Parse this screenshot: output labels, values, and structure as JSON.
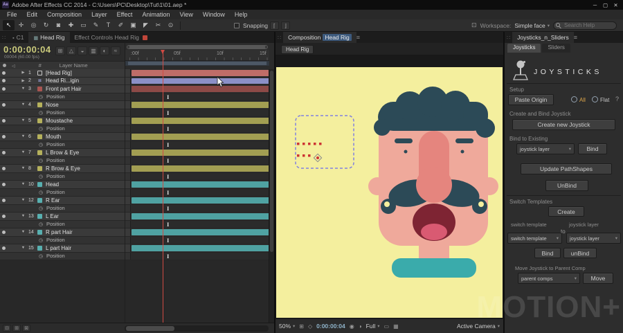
{
  "window": {
    "title": "Adobe After Effects CC 2014 - C:\\Users\\PC\\Desktop\\Tut\\1\\01.aep *",
    "logo": "Ae",
    "minimize": "─",
    "maximize": "▢",
    "close": "✕"
  },
  "menu": {
    "items": [
      "File",
      "Edit",
      "Composition",
      "Layer",
      "Effect",
      "Animation",
      "View",
      "Window",
      "Help"
    ]
  },
  "toolbar": {
    "tools": [
      {
        "name": "selection-tool",
        "glyph": "↖"
      },
      {
        "name": "hand-tool",
        "glyph": "✛"
      },
      {
        "name": "zoom-tool",
        "glyph": "◎"
      },
      {
        "name": "rotation-tool",
        "glyph": "↻"
      },
      {
        "name": "unified-camera-tool",
        "glyph": "◙"
      },
      {
        "name": "pan-behind-tool",
        "glyph": "✚"
      },
      {
        "name": "shape-tool",
        "glyph": "▭"
      },
      {
        "name": "pen-tool",
        "glyph": "✎"
      },
      {
        "name": "type-tool",
        "glyph": "T"
      },
      {
        "name": "brush-tool",
        "glyph": "✐"
      },
      {
        "name": "clone-stamp-tool",
        "glyph": "▣"
      },
      {
        "name": "eraser-tool",
        "glyph": "◤"
      },
      {
        "name": "roto-brush-tool",
        "glyph": "✂"
      },
      {
        "name": "puppet-pin-tool",
        "glyph": "⊙"
      }
    ],
    "snapping_label": "Snapping",
    "workspace_label": "Workspace:",
    "workspace_value": "Simple face",
    "search_placeholder": "Search Help"
  },
  "timeline": {
    "tab_c1": "C1",
    "tab_head_rig": "Head Rig",
    "tab_effect_controls": "Effect Controls Head Rig",
    "timecode": "0:00:00:04",
    "frame_info": "00004 (60.00 fps)",
    "col_hash": "#",
    "col_layer_name": "Layer Name",
    "ruler_ticks": [
      ":00f",
      "05f",
      "10f",
      "15f"
    ],
    "position_label": "Position",
    "header_icons": [
      {
        "name": "comp-mini-flowchart-icon",
        "glyph": "⊞"
      },
      {
        "name": "draft-3d-icon",
        "glyph": "△"
      },
      {
        "name": "shy-layers-icon",
        "glyph": "◒"
      },
      {
        "name": "frame-blending-icon",
        "glyph": "▥"
      },
      {
        "name": "motion-blur-icon",
        "glyph": "◐"
      },
      {
        "name": "graph-editor-icon",
        "glyph": "≈"
      }
    ],
    "footer_icons": [
      {
        "name": "toggle-switches-icon",
        "glyph": "⊟"
      },
      {
        "name": "transfer-controls-icon",
        "glyph": "⊞"
      },
      {
        "name": "inout-columns-icon",
        "glyph": "⊠"
      }
    ],
    "layers": [
      {
        "num": "1",
        "name": "[Head Rig]",
        "chip_style": "outline",
        "chip": "#cccccc",
        "bar": "#bf6d68",
        "expanded": false,
        "has_position": false
      },
      {
        "num": "2",
        "name": "Head Ri...igin",
        "chip_style": "hash",
        "chip": "#9aa0d8",
        "bar": "#8b90c7",
        "expanded": false,
        "has_position": false
      },
      {
        "num": "3",
        "name": "Front part Hair",
        "chip_style": "solid",
        "chip": "#a85551",
        "bar": "#8d4a47",
        "expanded": true,
        "has_position": true
      },
      {
        "num": "4",
        "name": "Nose",
        "chip_style": "solid",
        "chip": "#b5b15c",
        "bar": "#a29e52",
        "expanded": true,
        "has_position": true
      },
      {
        "num": "5",
        "name": "Moustache",
        "chip_style": "solid",
        "chip": "#b5b15c",
        "bar": "#a29e52",
        "expanded": true,
        "has_position": true
      },
      {
        "num": "6",
        "name": "Mouth",
        "chip_style": "solid",
        "chip": "#b5b15c",
        "bar": "#a29e52",
        "expanded": true,
        "has_position": true
      },
      {
        "num": "7",
        "name": "L Brow & Eye",
        "chip_style": "solid",
        "chip": "#b5b15c",
        "bar": "#a29e52",
        "expanded": true,
        "has_position": true
      },
      {
        "num": "8",
        "name": "R Brow & Eye",
        "chip_style": "solid",
        "chip": "#b5b15c",
        "bar": "#a29e52",
        "expanded": true,
        "has_position": true
      },
      {
        "num": "10",
        "name": "Head",
        "chip_style": "solid",
        "chip": "#58b0b0",
        "bar": "#4fa2a2",
        "expanded": true,
        "has_position": true
      },
      {
        "num": "12",
        "name": "R Ear",
        "chip_style": "solid",
        "chip": "#58b0b0",
        "bar": "#4fa2a2",
        "expanded": true,
        "has_position": true
      },
      {
        "num": "13",
        "name": "L Ear",
        "chip_style": "solid",
        "chip": "#58b0b0",
        "bar": "#4fa2a2",
        "expanded": true,
        "has_position": true
      },
      {
        "num": "14",
        "name": "R part Hair",
        "chip_style": "solid",
        "chip": "#58b0b0",
        "bar": "#4fa2a2",
        "expanded": true,
        "has_position": true
      },
      {
        "num": "15",
        "name": "L part Hair",
        "chip_style": "solid",
        "chip": "#58b0b0",
        "bar": "#4fa2a2",
        "expanded": true,
        "has_position": true
      }
    ]
  },
  "composition": {
    "tab_label": "Composition",
    "tab_comp_name": "Head Rig",
    "breadcrumb": "Head Rig",
    "status": {
      "zoom": "50%",
      "timecode": "0:00:00:04",
      "resolution": "Full",
      "view": "Active Camera"
    }
  },
  "joysticks": {
    "tab": "Joysticks_n_Sliders",
    "tab_joysticks": "Joysticks",
    "tab_sliders": "Sliders",
    "title": "JOYSTICKS",
    "setup_label": "Setup",
    "paste_origin": "Paste Origin",
    "all_label": "All",
    "flat_label": "Flat",
    "help": "?",
    "create_bind_label": "Create and Bind Joystick",
    "create_new_joystick": "Create new Joystick",
    "bind_existing_label": "Bind to Existing",
    "joystick_layer_dropdown": "joystick layer",
    "bind": "Bind",
    "update_pathshapes": "Update PathShapes",
    "unbind": "UnBind",
    "switch_templates_label": "Switch Templates",
    "create": "Create",
    "switch_template_col": "switch template",
    "joystick_layer_col": "joystick layer",
    "to": "to",
    "switch_template_dropdown": "switch template",
    "joystick_layer_dropdown2": "joystick layer",
    "bind2": "Bind",
    "unbind2": "unBind",
    "move_section_label": "Move Joystick to Parent Comp",
    "parent_comps_dropdown": "parent comps",
    "move": "Move"
  },
  "watermark": "MOTION+",
  "colors": {
    "canvas_yellow": "#f4ef9e",
    "face_pink": "#efa99b",
    "nose_pink": "#e5857e",
    "hair_teal": "#2c4a57",
    "mouth_red": "#7e2433",
    "tongue_pink": "#d95a72",
    "collar_teal": "#3aabab",
    "selection_purple": "#8080e0",
    "vertex_red": "#cc3333",
    "cti_red": "#d24a43",
    "timecode_yellow": "#cbcb7c",
    "timecode_blue": "#8fb3c9",
    "accent_orange": "#dda64a"
  }
}
